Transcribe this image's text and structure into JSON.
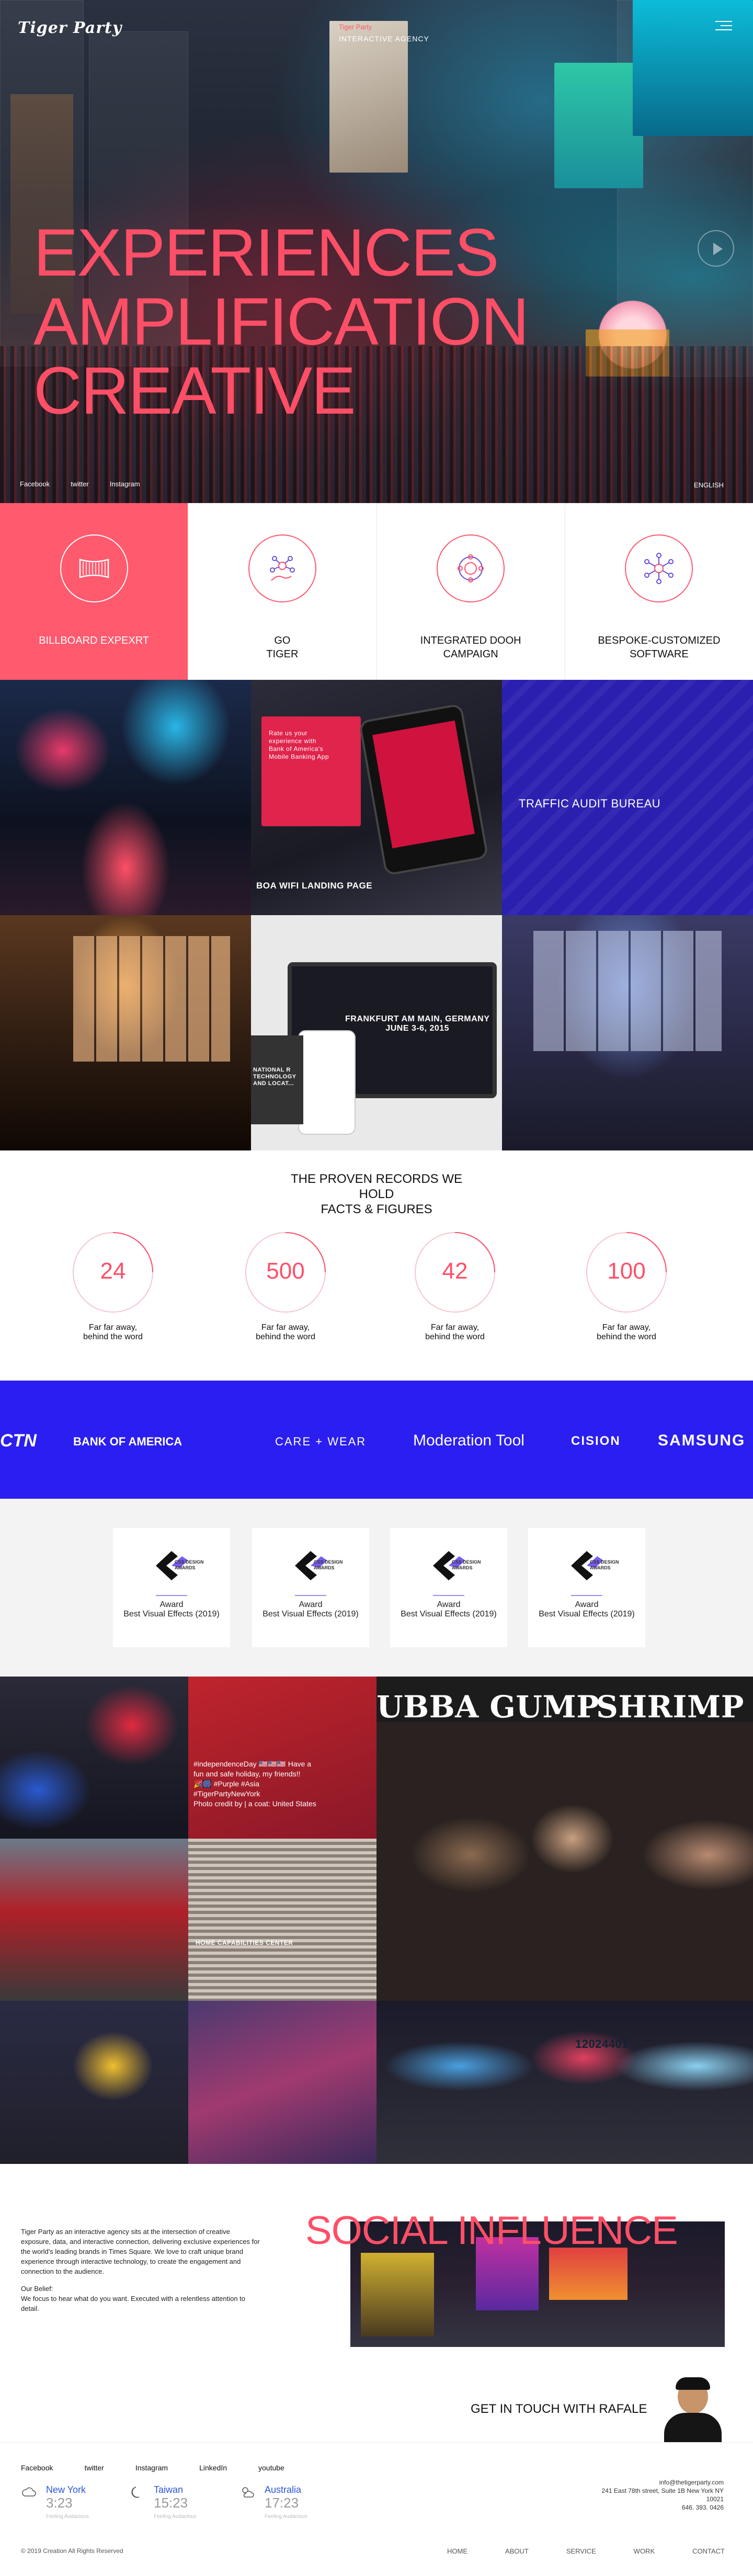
{
  "brand": {
    "logo": "Tiger Party",
    "tagline_sub": "Tiger Party",
    "tagline": "INTERACTIVE AGENCY",
    "accent": "#ff4f67",
    "blue": "#2b1ef0"
  },
  "hero": {
    "lines": [
      "EXPERIENCES",
      "AMPLIFICATION",
      "CREATIVE"
    ],
    "social": [
      "Facebook",
      "twitter",
      "Instagram"
    ],
    "language": "ENGLISH"
  },
  "services": [
    {
      "label": "BILLBOARD EXPEXRT",
      "icon": "billboard-icon"
    },
    {
      "label": "GO\nTIGER",
      "icon": "network-hand-icon"
    },
    {
      "label": "INTEGRATED DOOH\nCAMPAIGN",
      "icon": "hands-circle-icon"
    },
    {
      "label": "BESPOKE-CUSTOMIZED\nSOFTWARE",
      "icon": "hub-icon"
    }
  ],
  "portfolio": {
    "boa": "BOA WIFI LANDING PAGE",
    "tab": "TRAFFIC AUDIT BUREAU",
    "frankfurt": "FRANKFURT AM MAIN, GERMANY\nJUNE 3-6, 2015",
    "national": "NATIONAL R\nTECHNOLOGY\nAND LOCAT...",
    "boa_screen": "Rate us your\nexperience with\nBank of America's\nMobile Banking App"
  },
  "stats": {
    "title": "THE PROVEN RECORDS WE\nHOLD\nFACTS & FIGURES",
    "items": [
      {
        "value": "24",
        "text": "Far far away,\nbehind the word"
      },
      {
        "value": "500",
        "text": "Far far away,\nbehind the word"
      },
      {
        "value": "42",
        "text": "Far far away,\nbehind the word"
      },
      {
        "value": "100",
        "text": "Far far away,\nbehind the word"
      }
    ]
  },
  "clients": [
    "CTN",
    "BANK OF AMERICA",
    "CARE + WEAR",
    "Moderation Tool",
    "CISION",
    "SAMSUNG"
  ],
  "awards": {
    "badge": "CSS DESIGN\nAWARDS",
    "items": [
      {
        "l1": "Award",
        "l2": "Best Visual Effects (2019)"
      },
      {
        "l1": "Award",
        "l2": "Best Visual Effects (2019)"
      },
      {
        "l1": "Award",
        "l2": "Best Visual Effects (2019)"
      },
      {
        "l1": "Award",
        "l2": "Best Visual Effects (2019)"
      }
    ]
  },
  "social_grid": {
    "insta_text": "#independenceDay 🇺🇸🇺🇸🇺🇸 Have a\nfun and safe holiday, my friends!!\n🎉🎆 #Purple #Asia\n#TigerPartyNewYork\nPhoto credit by | a coat: United States",
    "capabilities": "HOME CAPABILITIES CENTER",
    "shrimp": "SHRIMP",
    "gump": "UBBA GUMP",
    "counter": "12024401"
  },
  "about": {
    "p1": "Tiger Party as an interactive agency sits at the intersection of creative exposure, data, and interactive connection, delivering exclusive experiences for the world's leading brands in Times Square. We love to craft unique brand experience through interactive technology, to create the engagement and connection to the audience.",
    "p2_title": "Our Belief:",
    "p2": "We focus to hear what do you want. Executed with a relentless attention to detail.",
    "social_title": "SOCIAL INFLUENCE",
    "cta": "GET IN TOUCH WITH RAFALE"
  },
  "footer": {
    "social": [
      "Facebook",
      "twitter",
      "Instagram",
      "LinkedIn",
      "youtube"
    ],
    "cities": [
      {
        "name": "New York",
        "time": "3:23",
        "feel": "Feeling Audacious",
        "icon": "cloud-icon"
      },
      {
        "name": "Taiwan",
        "time": "15:23",
        "feel": "Feeling Audacious",
        "icon": "moon-icon"
      },
      {
        "name": "Australia",
        "time": "17:23",
        "feel": "Feeling Audacious",
        "icon": "cloud-sun-icon"
      }
    ],
    "contact": "info@thetigerparty.com\n241 East 78th street, Suite 1B New York  NY\n10021\n646. 393. 0426",
    "copyright": "© 2019 Creation All Rights Reserved",
    "nav": [
      "HOME",
      "ABOUT",
      "SERVICE",
      "WORK",
      "CONTACT"
    ]
  }
}
